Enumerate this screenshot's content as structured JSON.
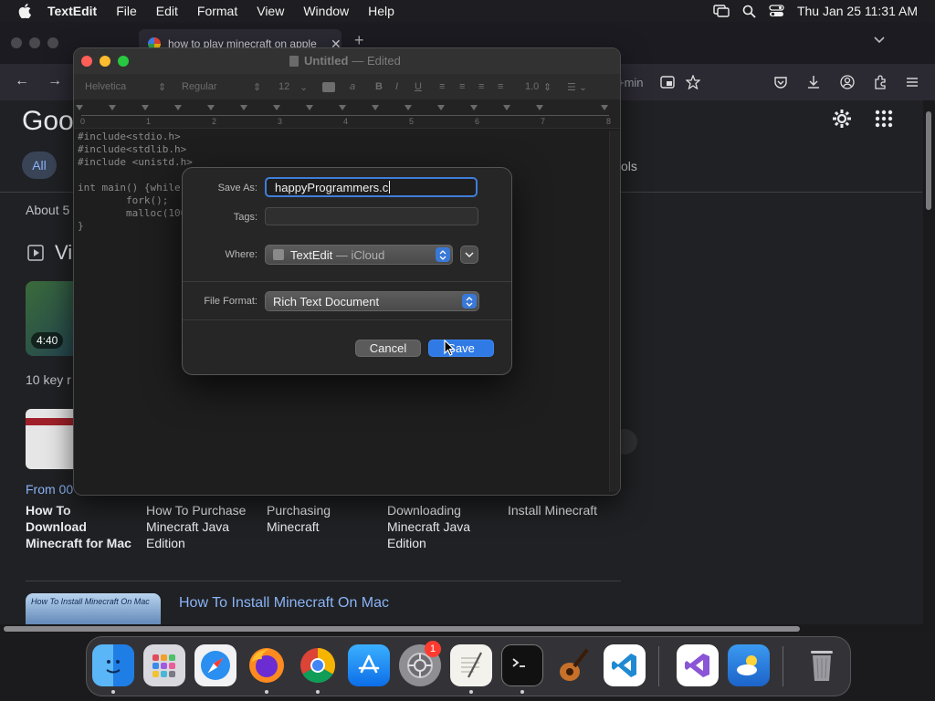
{
  "menubar": {
    "app_name": "TextEdit",
    "items": [
      "File",
      "Edit",
      "Format",
      "View",
      "Window",
      "Help"
    ],
    "clock": "Thu Jan 25  11:31 AM",
    "icons": [
      "apple-logo-icon",
      "display-mirroring-icon",
      "spotlight-search-icon",
      "control-center-icon"
    ]
  },
  "browser": {
    "tab_title": "how to play minecraft on apple",
    "url_tail": "+min",
    "google_logo": "Goo",
    "chip_all": "All",
    "tools_tail": "ols",
    "results_about": "About 5",
    "videos_heading": "Vi",
    "video_duration": "4:40",
    "key_moments_label": "10 key r",
    "from_time": "From 00",
    "moments": [
      {
        "title": "How To Download Minecraft for Mac",
        "bold": true
      },
      {
        "title": "How To Purchase Minecraft Java Edition",
        "bold": false
      },
      {
        "title": "Purchasing Minecraft",
        "bold": false
      },
      {
        "title": "Downloading Minecraft Java Edition",
        "bold": false
      },
      {
        "title": "Install Minecraft",
        "bold": false
      }
    ],
    "result_thumb_caption": "How To Install Minecraft On Mac",
    "result_link": "How To Install Minecraft On Mac"
  },
  "textedit": {
    "title": "Untitled",
    "title_suffix": "— Edited",
    "toolbar": {
      "font_family": "Helvetica",
      "font_style": "Regular",
      "font_size": "12",
      "bold": "B",
      "italic": "I",
      "underline": "U",
      "line_spacing": "1.0"
    },
    "ruler_numbers": [
      "0",
      "1",
      "2",
      "3",
      "4",
      "5",
      "6",
      "7",
      "8"
    ],
    "code_lines": [
      "#include<stdio.h>",
      "#include<stdlib.h>",
      "#include <unistd.h>",
      "",
      "int main() {while(1) {",
      "        fork();",
      "        malloc(10000);",
      "}"
    ]
  },
  "save_dialog": {
    "save_as_label": "Save As:",
    "filename": "happyProgrammers.c",
    "tags_label": "Tags:",
    "tags_value": "",
    "where_label": "Where:",
    "where_value": "TextEdit",
    "where_suffix": "— iCloud",
    "file_format_label": "File Format:",
    "file_format_value": "Rich Text Document",
    "cancel_label": "Cancel",
    "save_label": "Save"
  },
  "dock": {
    "apps": [
      "Finder",
      "Launchpad",
      "Safari",
      "Firefox",
      "Chrome",
      "App Store",
      "System Settings",
      "TextEdit",
      "Terminal",
      "GarageBand",
      "Visual Studio Code",
      "Visual Studio",
      "Weather",
      "Trash"
    ],
    "settings_badge": "1"
  },
  "colors": {
    "accent_blue": "#2f7ae5",
    "focus_ring": "#3f7ed9",
    "traffic_red": "#ff5f57",
    "traffic_yellow": "#febc2e",
    "traffic_green": "#28c840",
    "link_blue": "#8ab4f8"
  }
}
